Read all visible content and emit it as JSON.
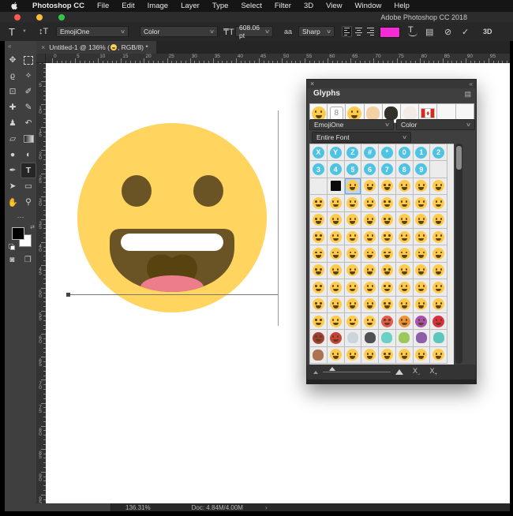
{
  "menu_bar": {
    "items": [
      "Photoshop CC",
      "File",
      "Edit",
      "Image",
      "Layer",
      "Type",
      "Select",
      "Filter",
      "3D",
      "View",
      "Window",
      "Help"
    ]
  },
  "title_bar": {
    "app_title": "Adobe Photoshop CC 2018"
  },
  "options_bar": {
    "tool_letter": "T",
    "font_family": "EmojiOne",
    "font_style": "Color",
    "font_size": "608.06 pt",
    "anti_alias": "Sharp",
    "anti_alias_icon": "aa",
    "size_icon": "₸T",
    "orientation_icon": "↕T",
    "swatch_color": "#f72bd5",
    "cancel_icon": "⊘",
    "commit_icon": "✓",
    "three_d_label": "3D"
  },
  "document_tab": {
    "prefix": "Untitled-1 @ 136% (",
    "suffix": ", RGB/8) *",
    "close": "×"
  },
  "toolbar": {
    "collapse": "«",
    "ellipsis": "⋯",
    "tools": [
      {
        "name": "move-tool",
        "glyph": "✥"
      },
      {
        "name": "marquee-tool",
        "glyph": "",
        "kind": "marquee"
      },
      {
        "name": "lasso-tool",
        "glyph": "ϱ"
      },
      {
        "name": "quick-selection-tool",
        "glyph": "✧"
      },
      {
        "name": "crop-tool",
        "glyph": "⊡"
      },
      {
        "name": "eyedropper-tool",
        "glyph": "✐"
      },
      {
        "name": "healing-brush-tool",
        "glyph": "✚"
      },
      {
        "name": "brush-tool",
        "glyph": "✎"
      },
      {
        "name": "clone-stamp-tool",
        "glyph": "♟"
      },
      {
        "name": "history-brush-tool",
        "glyph": "↶"
      },
      {
        "name": "eraser-tool",
        "glyph": "▱"
      },
      {
        "name": "gradient-tool",
        "glyph": "",
        "kind": "gradient"
      },
      {
        "name": "blur-tool",
        "glyph": "●"
      },
      {
        "name": "dodge-tool",
        "glyph": "◐"
      },
      {
        "name": "pen-tool",
        "glyph": "✒"
      },
      {
        "name": "type-tool",
        "glyph": "T",
        "active": true
      },
      {
        "name": "path-selection-tool",
        "glyph": "➤"
      },
      {
        "name": "shape-tool",
        "glyph": "▭"
      },
      {
        "name": "hand-tool",
        "glyph": "✋"
      },
      {
        "name": "zoom-tool",
        "glyph": "⚲"
      }
    ],
    "quick_mask_icon": "◙",
    "screen_mode_icon": "❐"
  },
  "rulers": {
    "horizontal": {
      "start": 0,
      "major_step": 5,
      "max": 100
    },
    "vertical": {
      "start": 0,
      "major_step": 5,
      "max": 97,
      "last_label": 95
    }
  },
  "canvas": {
    "emoji": {
      "character": "😀",
      "face_color": "#ffd45f",
      "feature_color": "#6a5426",
      "inner_mouth_color": "#57430f",
      "tongue_color": "#ee7d8b",
      "teeth_color": "#ffffff"
    },
    "baseline_color": "#777777",
    "cursor_color": "#999999"
  },
  "glyphs_panel": {
    "title": "Glyphs",
    "close": "×",
    "collapse": "«",
    "font_family": "EmojiOne",
    "font_style": "Color",
    "scope": "Entire Font",
    "default_face_color": "#ffcb4c",
    "recent": [
      "f:😀",
      "w:8",
      "f:😄",
      "p:✌:#f3d1a4",
      "p:🎩:#33302c",
      "p:🎂:#f4ede7",
      "g:🇨🇦",
      "",
      ""
    ],
    "grid": [
      [
        "k:X",
        "k:Y",
        "k:Z",
        "k:#",
        "k:*",
        "k:0",
        "k:1",
        "k:2"
      ],
      [
        "k:3",
        "k:4",
        "k:5",
        "k:6",
        "k:7",
        "k:8",
        "k:9",
        ""
      ],
      [
        "",
        "b:",
        "f:😀",
        "f:😁",
        "f:😂",
        "f:😃",
        "f:😄",
        "f:😅"
      ],
      [
        "f:😆",
        "f:😉",
        "f:😊",
        "f:😋",
        "f:😎",
        "f:😍",
        "f:😘",
        "f:😗"
      ],
      [
        "f:😙",
        "f:😚",
        "f:☺",
        "f:🙂",
        "f:🤗",
        "f:😇",
        "f:🤔",
        "f:😐"
      ],
      [
        "f:😑",
        "f:😶",
        "f:🙄",
        "f:😏",
        "f:😣",
        "f:😥",
        "f:😮",
        "f:😯"
      ],
      [
        "f:😪",
        "f:🤤",
        "f:😴",
        "f:🤑",
        "f:😌",
        "f:🤓",
        "f:😛",
        "f:😜"
      ],
      [
        "f:😝",
        "f:🙁",
        "f:😕",
        "f:😟",
        "f:😓",
        "f:😒",
        "f:😔",
        "f:😞"
      ],
      [
        "f:🙃",
        "f:🤧",
        "f:🤒",
        "f:🤕",
        "f:🤢",
        "f:😨",
        "f:😧",
        "f:😦"
      ],
      [
        "f:😤",
        "f:😢",
        "f:😭",
        "f:😩",
        "f:😫",
        "f:😖",
        "f:😬",
        "f:🤥"
      ],
      [
        "f:😰",
        "f:😱",
        "f:😳",
        "f:😵",
        "f:😡:#e45a4e",
        "f:😠:#ed9137",
        "f:😈:#a94fb0",
        "f:👿:#dd2e44"
      ],
      [
        "f:👹:#a43e35",
        "f:👺:#c64138",
        "p:💀:#cbd5db",
        "p:☠:#4f5054",
        "p:👻:#69d1c6",
        "p:👽:#9bc95b",
        "p:👾:#8c5fa8",
        "p:🤖:#5ec7bd"
      ],
      [
        "p:💩:#ac7352",
        "f:😺",
        "f:😸",
        "f:😹",
        "f:😻",
        "f:😼",
        "f:😽",
        "f:🙀"
      ]
    ],
    "selected_cell": {
      "row": 2,
      "col": 2
    }
  },
  "status_bar": {
    "zoom_level": "136.31%",
    "doc_info": "Doc: 4.84M/4.00M",
    "chevron": "›"
  }
}
